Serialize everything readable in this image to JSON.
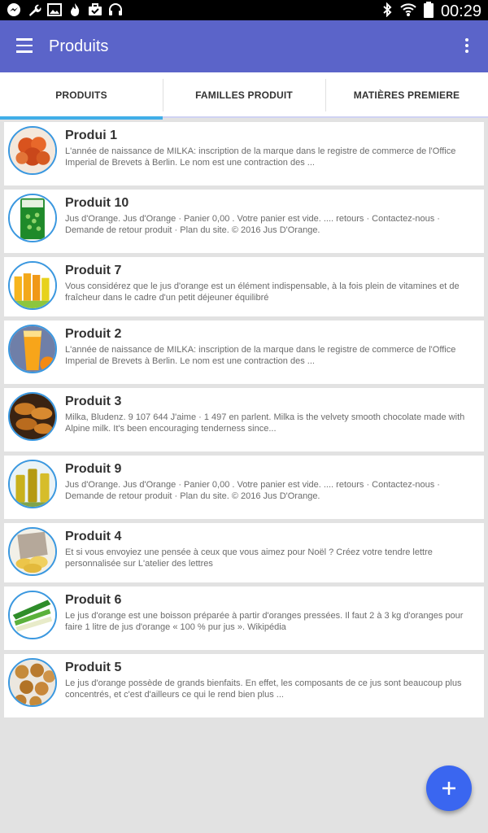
{
  "status_bar": {
    "icons_left": [
      "messenger-icon",
      "wrench-icon",
      "image-icon",
      "flame-icon",
      "briefcase-icon",
      "headset-icon"
    ],
    "icons_right": [
      "bluetooth-icon",
      "wifi-icon",
      "battery-icon"
    ],
    "time": "00:29"
  },
  "app_bar": {
    "title": "Produits",
    "color": "#5b64c9"
  },
  "tabs": [
    {
      "label": "PRODUITS",
      "active": true
    },
    {
      "label": "FAMILLES PRODUIT",
      "active": false
    },
    {
      "label": "MATIÈRES PREMIERE",
      "active": false
    }
  ],
  "accent_color": "#40aee8",
  "products": [
    {
      "name": "Produi 1",
      "image": "shrimp-image",
      "description": "L'année de naissance de MILKA: inscription de la marque dans le registre de commerce de l'Office Imperial de Brevets à Berlin. Le nom est une contraction des ..."
    },
    {
      "name": "Produit 10",
      "image": "peas-bag-image",
      "description": "Jus d'Orange. Jus d'Orange · Panier 0,00  . Votre panier est vide. .... retours · Contactez-nous · Demande de retour produit · Plan du site. © 2016 Jus D'Orange."
    },
    {
      "name": "Produit 7",
      "image": "juice-bottles-image",
      "description": "Vous considérez que le jus d'orange est un élément indispensable, à la fois plein de vitamines et de fraîcheur dans le cadre d'un petit déjeuner équilibré"
    },
    {
      "name": "Produit 2",
      "image": "orange-juice-glass-image",
      "description": "L'année de naissance de MILKA: inscription de la marque dans le registre de commerce de l'Office Imperial de Brevets à Berlin. Le nom est une contraction des ..."
    },
    {
      "name": "Produit 3",
      "image": "croissants-image",
      "description": "Milka, Bludenz. 9 107 644 J'aime · 1 497 en parlent. Milka is the velvety smooth chocolate made with Alpine milk. It's been encouraging tenderness since..."
    },
    {
      "name": "Produit 9",
      "image": "oil-bottles-image",
      "description": "Jus d'Orange. Jus d'Orange · Panier 0,00  . Votre panier est vide. .... retours · Contactez-nous · Demande de retour produit · Plan du site. © 2016 Jus D'Orange."
    },
    {
      "name": "Produit 4",
      "image": "chips-image",
      "description": "Et si vous envoyiez une pensée à ceux que vous aimez pour Noël ? Créez votre tendre lettre personnalisée sur L'atelier des lettres"
    },
    {
      "name": "Produit 6",
      "image": "leeks-image",
      "description": "Le jus d'orange est une boisson préparée à partir d'oranges pressées. Il faut 2 à 3 kg d'oranges pour faire 1 litre de jus d'orange « 100 % pur jus ». Wikipédia"
    },
    {
      "name": "Produit 5",
      "image": "muffins-image",
      "description": "Le jus d'orange possède de grands bienfaits. En effet, les composants de ce jus sont beaucoup plus concentrés, et c'est d'ailleurs ce qui le rend bien plus ..."
    }
  ],
  "fab": {
    "icon": "plus-icon",
    "color": "#3a66f0"
  }
}
